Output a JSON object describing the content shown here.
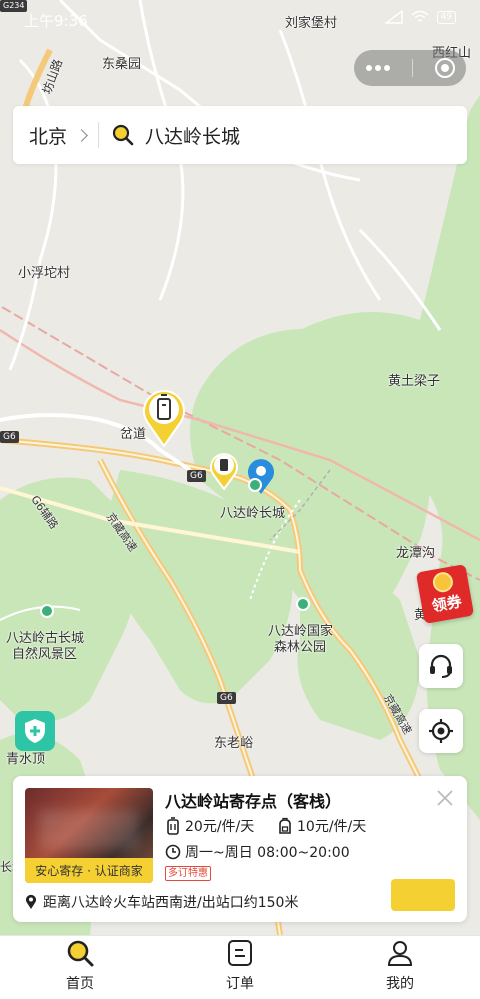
{
  "status_bar": {
    "time": "上午9:36",
    "battery": "49"
  },
  "search": {
    "city": "北京",
    "query": "八达岭长城"
  },
  "map": {
    "places": {
      "liujiabao": "刘家堡村",
      "dongsangyuan": "东桑园",
      "xihongshan": "西红山",
      "xiaofutuo": "小浮坨村",
      "huangtuliangzi": "黄土梁子",
      "chadao": "岔道",
      "badaling": "八达岭长城",
      "longtangou": "龙潭沟",
      "gucheng_1": "八达岭古长城",
      "gucheng_2": "自然风景区",
      "forest_1": "八达岭国家",
      "forest_2": "森林公园",
      "donglaoyu": "东老峪",
      "qingshuiding": "青水顶",
      "huang": "黄",
      "chang": "长城",
      "road_sign": "坊山路"
    },
    "roads": {
      "g6_a": "G6",
      "g6_b": "G6",
      "g6_c": "G6",
      "jingzang_a": "京藏高速",
      "jingzang_b": "京藏高速",
      "g6_label": "G6辅路",
      "g234": "G234"
    }
  },
  "floating": {
    "coupon_label": "领券"
  },
  "card": {
    "title": "八达岭站寄存点（客栈）",
    "badge": "安心寄存 · 认证商家",
    "price_large": "20元/件/天",
    "price_small": "10元/件/天",
    "hours": "周一~周日 08:00~20:00",
    "promo": "多订特惠",
    "address": "距离八达岭火车站西南进/出站口约150米",
    "book_label": ""
  },
  "tabs": [
    {
      "label": "首页",
      "icon": "search-icon"
    },
    {
      "label": "订单",
      "icon": "order-icon"
    },
    {
      "label": "我的",
      "icon": "profile-icon"
    }
  ],
  "colors": {
    "accent": "#f5d033",
    "map_green": "#c9e6b9",
    "map_bg": "#eceae5",
    "road": "#f5c97a",
    "pin_blue": "#2a8cdc",
    "coupon_red": "#e02a2a",
    "safe_teal": "#2ec4a6"
  }
}
